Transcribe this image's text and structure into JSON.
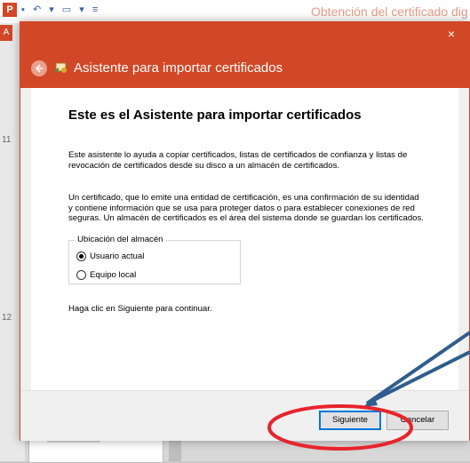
{
  "background_app": {
    "app_letter": "P",
    "quick_access": "▪ ↶ ▾ ▭ ▾ ≡",
    "doc_title": "Obtención del certificado dig",
    "file_tab": "A",
    "slide_numbers": [
      "11",
      "12"
    ]
  },
  "dialog": {
    "close_symbol": "×",
    "title": "Asistente para importar certificados",
    "heading": "Este es el Asistente para importar certificados",
    "paragraph1": "Este asistente lo ayuda a copiar certificados, listas de certificados de confianza y listas de revocación de certificados desde su disco a un almacén de certificados.",
    "paragraph2": "Un certificado, que lo emite una entidad de certificación, es una confirmación de su identidad y contiene información que se usa para proteger datos o para establecer conexiones de red seguras. Un almacén de certificados es el área del sistema donde se guardan los certificados.",
    "store_location": {
      "legend": "Ubicación del almacén",
      "options": [
        {
          "label": "Usuario actual",
          "selected": true
        },
        {
          "label": "Equipo local",
          "selected": false
        }
      ]
    },
    "paragraph3": "Haga clic en Siguiente para continuar.",
    "buttons": {
      "next": "Siguiente",
      "cancel": "Cancelar"
    }
  },
  "colors": {
    "accent": "#d24726",
    "annotation_red": "#e8242b",
    "arrow_blue": "#2f5d8e"
  }
}
